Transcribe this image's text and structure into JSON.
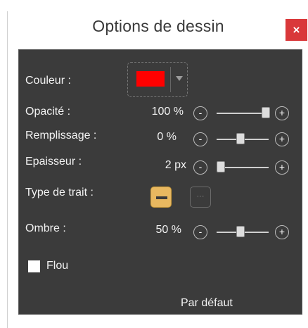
{
  "window": {
    "title": "Options de dessin",
    "close_glyph": "×"
  },
  "controls": {
    "color": {
      "label": "Couleur :",
      "value": "#ff0000"
    },
    "opacity": {
      "label": "Opacité :",
      "value": "100 %",
      "level": 1.0
    },
    "fill": {
      "label": "Remplissage :",
      "value": "0 %",
      "level": 0.5
    },
    "thickness": {
      "label": "Epaisseur :",
      "value": "2 px",
      "level": 0.08
    },
    "stroke_type": {
      "label": "Type de trait :",
      "options": [
        "solid",
        "dashed"
      ],
      "selected": "solid"
    },
    "shadow": {
      "label": "Ombre :",
      "value": "50 %",
      "level": 0.5
    }
  },
  "blur": {
    "label": "Flou",
    "checked": false
  },
  "default_button": {
    "label": "Par défaut"
  },
  "colors": {
    "panel": "#3b3b3b",
    "accent": "#e8b860",
    "close": "#d9383a"
  }
}
